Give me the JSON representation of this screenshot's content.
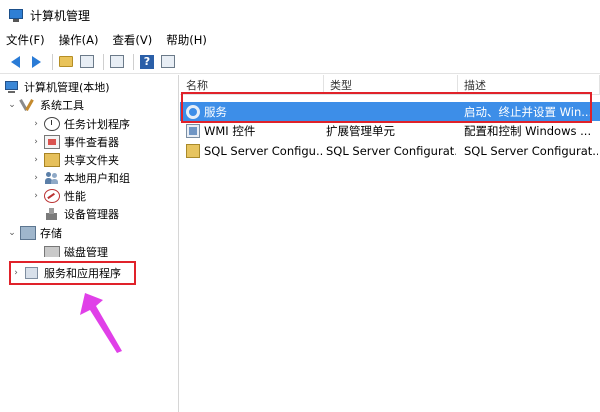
{
  "window": {
    "title": "计算机管理"
  },
  "menu": [
    "文件(F)",
    "操作(A)",
    "查看(V)",
    "帮助(H)"
  ],
  "toolbar": {
    "help_label": "?"
  },
  "tree": {
    "root": "计算机管理(本地)",
    "system_tools": "系统工具",
    "task_scheduler": "任务计划程序",
    "event_viewer": "事件查看器",
    "shared_folders": "共享文件夹",
    "local_users": "本地用户和组",
    "performance": "性能",
    "device_manager": "设备管理器",
    "storage": "存储",
    "disk_management": "磁盘管理",
    "services_apps": "服务和应用程序"
  },
  "list": {
    "columns": [
      "名称",
      "类型",
      "描述"
    ],
    "rows": [
      {
        "name": "服务",
        "type": "",
        "desc": "启动、终止并设置 Win..."
      },
      {
        "name": "WMI 控件",
        "type": "扩展管理单元",
        "desc": "配置和控制 Windows ..."
      },
      {
        "name": "SQL Server Configu...",
        "type": "SQL Server Configurat...",
        "desc": "SQL Server Configurat..."
      }
    ]
  },
  "colors": {
    "selection": "#3d8ee8",
    "annotation_red": "#e0222a",
    "annotation_arrow": "#e040e8"
  },
  "icons": [
    "computer-icon",
    "tools-icon",
    "clock-icon",
    "event-icon",
    "shared-folder-icon",
    "users-icon",
    "performance-icon",
    "device-manager-icon",
    "storage-icon",
    "disk-icon",
    "services-icon",
    "gear-icon",
    "wmi-icon",
    "sql-icon"
  ]
}
